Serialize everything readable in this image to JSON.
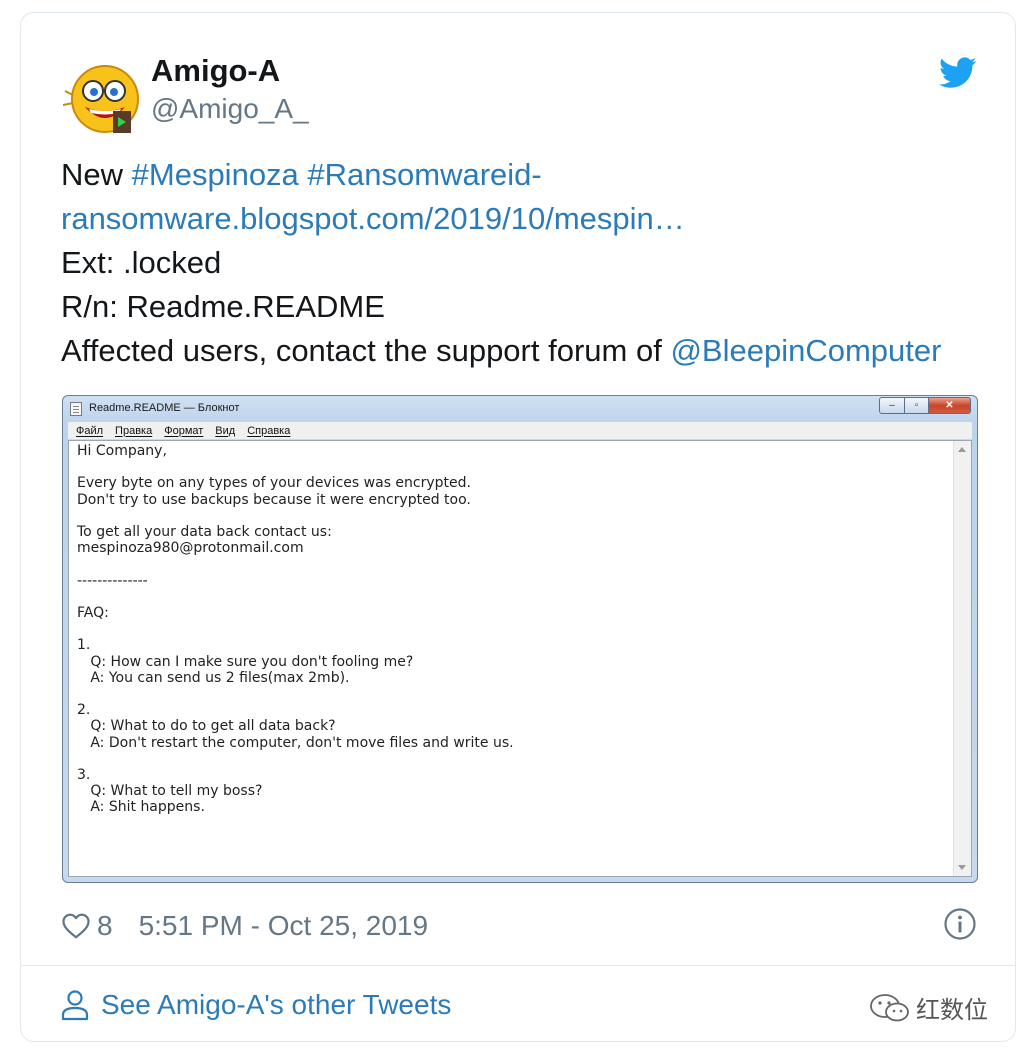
{
  "tweet": {
    "author_name": "Amigo-A",
    "author_handle": "@Amigo_A_",
    "text_prefix": "New",
    "hashtag_1": "#Mespinoza",
    "hashtag_2": "#Ransomwareid-",
    "link": "ransomware.blogspot.com/2019/10/mespin…",
    "ext_line": "Ext: .locked",
    "rn_line": "R/n: Readme.README",
    "affected_prefix": "Affected users, contact the support forum of",
    "mention": "@BleepinComputer",
    "likes": "8",
    "timestamp": "5:51 PM - Oct 25, 2019",
    "other_tweets": "See Amigo-A's other Tweets"
  },
  "notepad": {
    "title": "Readme.README — Блокнот",
    "menu": [
      "Файл",
      "Правка",
      "Формат",
      "Вид",
      "Справка"
    ],
    "content": "Hi Company,\n\nEvery byte on any types of your devices was encrypted.\nDon't try to use backups because it were encrypted too.\n\nTo get all your data back contact us:\nmespinoza980@protonmail.com\n\n--------------\n\nFAQ:\n\n1.\n   Q: How can I make sure you don't fooling me?\n   A: You can send us 2 files(max 2mb).\n\n2.\n   Q: What to do to get all data back?\n   A: Don't restart the computer, don't move files and write us.\n\n3.\n   Q: What to tell my boss?\n   A: Shit happens."
  },
  "watermark": {
    "text": "红数位"
  },
  "colors": {
    "link": "#2b7bb9",
    "muted": "#657786",
    "twitter_blue": "#1da1f2"
  }
}
